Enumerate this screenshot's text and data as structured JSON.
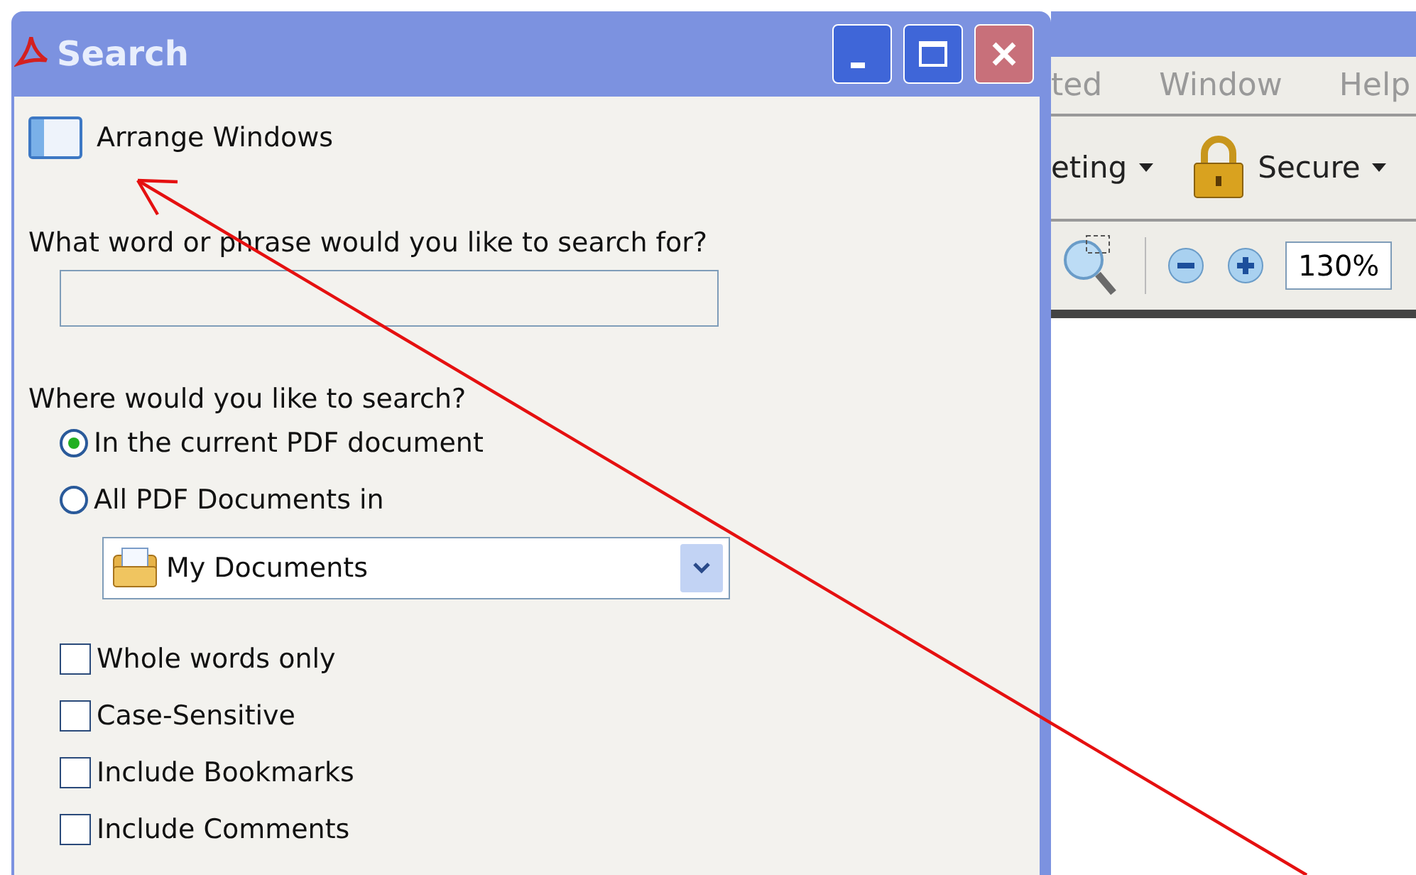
{
  "dialog": {
    "title": "Search",
    "arrange_windows": "Arrange Windows",
    "question": "What word or phrase would you like to search for?",
    "where_label": "Where would you like to search?",
    "scope_options": [
      {
        "label": "In the current PDF document",
        "selected": true
      },
      {
        "label": "All PDF Documents in",
        "selected": false
      }
    ],
    "location": "My Documents",
    "options": [
      {
        "label": "Whole words only",
        "checked": false
      },
      {
        "label": "Case-Sensitive",
        "checked": false
      },
      {
        "label": "Include Bookmarks",
        "checked": false
      },
      {
        "label": "Include Comments",
        "checked": false
      }
    ]
  },
  "app": {
    "menu_bar": [
      "ted",
      "Window",
      "Help"
    ],
    "toolbar": [
      {
        "label": "eting",
        "kind": "plain"
      },
      {
        "label": "Secure",
        "kind": "lock"
      }
    ],
    "zoom_field": "130%"
  }
}
